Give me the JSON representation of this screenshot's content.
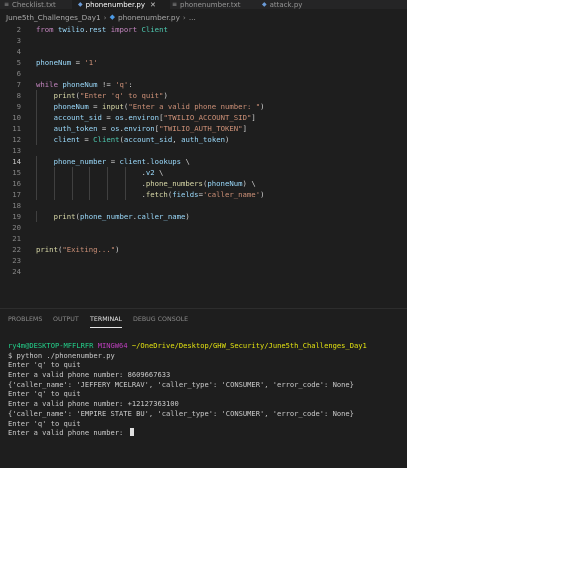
{
  "tabs": [
    {
      "label": "Checklist.txt",
      "active": false
    },
    {
      "label": "phonenumber.py",
      "active": true
    },
    {
      "label": "phonenumber.txt",
      "active": false
    },
    {
      "label": "attack.py",
      "active": false
    }
  ],
  "breadcrumb": {
    "folder": "June5th_Challenges_Day1",
    "file": "phonenumber.py",
    "more": "..."
  },
  "editor": {
    "current_line": "14",
    "lines": [
      {
        "n": "2",
        "code": "from twilio.rest import Client"
      },
      {
        "n": "3",
        "code": ""
      },
      {
        "n": "4",
        "code": ""
      },
      {
        "n": "5",
        "code": "phoneNum = '1'"
      },
      {
        "n": "6",
        "code": ""
      },
      {
        "n": "7",
        "code": "while phoneNum != 'q':"
      },
      {
        "n": "8",
        "code": "    print(\"Enter 'q' to quit\")"
      },
      {
        "n": "9",
        "code": "    phoneNum = input(\"Enter a valid phone number: \")"
      },
      {
        "n": "10",
        "code": "    account_sid = os.environ[\"TWILIO_ACCOUNT_SID\"]"
      },
      {
        "n": "11",
        "code": "    auth_token = os.environ[\"TWILIO_AUTH_TOKEN\"]"
      },
      {
        "n": "12",
        "code": "    client = Client(account_sid, auth_token)"
      },
      {
        "n": "13",
        "code": ""
      },
      {
        "n": "14",
        "code": "    phone_number = client.lookups \\"
      },
      {
        "n": "15",
        "code": "                        .v2 \\"
      },
      {
        "n": "16",
        "code": "                        .phone_numbers(phoneNum) \\"
      },
      {
        "n": "17",
        "code": "                        .fetch(fields='caller_name')"
      },
      {
        "n": "18",
        "code": ""
      },
      {
        "n": "19",
        "code": "    print(phone_number.caller_name)"
      },
      {
        "n": "20",
        "code": ""
      },
      {
        "n": "21",
        "code": ""
      },
      {
        "n": "22",
        "code": "print(\"Exiting...\")"
      },
      {
        "n": "23",
        "code": ""
      },
      {
        "n": "24",
        "code": ""
      }
    ]
  },
  "panel": {
    "tabs": [
      {
        "label": "PROBLEMS",
        "active": false
      },
      {
        "label": "OUTPUT",
        "active": false
      },
      {
        "label": "TERMINAL",
        "active": true
      },
      {
        "label": "DEBUG CONSOLE",
        "active": false
      }
    ]
  },
  "terminal": {
    "prompt_user": "ry4m@DESKTOP-MFFLRFR",
    "prompt_env": "MINGW64",
    "prompt_path": "~/OneDrive/Desktop/GHW_Security/June5th_Challenges_Day1",
    "lines": [
      "$ python ./phonenumber.py",
      "Enter 'q' to quit",
      "Enter a valid phone number: 8609667633",
      "{'caller_name': 'JEFFERY MCELRAV', 'caller_type': 'CONSUMER', 'error_code': None}",
      "Enter 'q' to quit",
      "Enter a valid phone number: +12127363100",
      "{'caller_name': 'EMPIRE STATE BU', 'caller_type': 'CONSUMER', 'error_code': None}",
      "Enter 'q' to quit"
    ],
    "current_input": "Enter a valid phone number: "
  },
  "colors": {
    "editor_bg": "#1e1e1e",
    "keyword": "#c586c0",
    "function": "#dcdcaa",
    "variable": "#9cdcfe",
    "string": "#ce9178",
    "class": "#4ec9b0",
    "prompt_user": "#23d18b",
    "prompt_env": "#bc3fbc",
    "prompt_path": "#e5e510"
  }
}
